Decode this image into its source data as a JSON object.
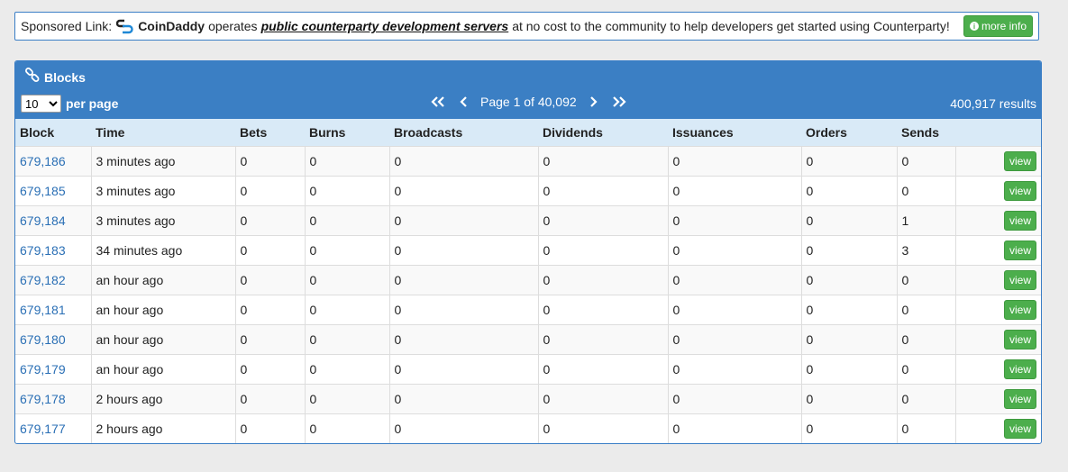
{
  "sponsor": {
    "prefix": "Sponsored Link:",
    "brand": "CoinDaddy",
    "text1": "operates",
    "link": "public counterparty development servers",
    "text2": "at no cost to the community to help developers get started using Counterparty!",
    "more_info": "more info",
    "logo_icon": "coindaddy-logo-icon",
    "info_icon": "info-circle-icon"
  },
  "panel": {
    "title": "Blocks",
    "title_icon": "link-icon",
    "per_page_value": "10",
    "per_page_options": [
      "10"
    ],
    "per_page_label": "per page",
    "page_text": "Page 1 of 40,092",
    "results": "400,917 results"
  },
  "table": {
    "headers": [
      "Block",
      "Time",
      "Bets",
      "Burns",
      "Broadcasts",
      "Dividends",
      "Issuances",
      "Orders",
      "Sends"
    ],
    "view_label": "view",
    "rows": [
      {
        "block": "679,186",
        "time": "3 minutes ago",
        "bets": "0",
        "burns": "0",
        "broadcasts": "0",
        "dividends": "0",
        "issuances": "0",
        "orders": "0",
        "sends": "0"
      },
      {
        "block": "679,185",
        "time": "3 minutes ago",
        "bets": "0",
        "burns": "0",
        "broadcasts": "0",
        "dividends": "0",
        "issuances": "0",
        "orders": "0",
        "sends": "0"
      },
      {
        "block": "679,184",
        "time": "3 minutes ago",
        "bets": "0",
        "burns": "0",
        "broadcasts": "0",
        "dividends": "0",
        "issuances": "0",
        "orders": "0",
        "sends": "1"
      },
      {
        "block": "679,183",
        "time": "34 minutes ago",
        "bets": "0",
        "burns": "0",
        "broadcasts": "0",
        "dividends": "0",
        "issuances": "0",
        "orders": "0",
        "sends": "3"
      },
      {
        "block": "679,182",
        "time": "an hour ago",
        "bets": "0",
        "burns": "0",
        "broadcasts": "0",
        "dividends": "0",
        "issuances": "0",
        "orders": "0",
        "sends": "0"
      },
      {
        "block": "679,181",
        "time": "an hour ago",
        "bets": "0",
        "burns": "0",
        "broadcasts": "0",
        "dividends": "0",
        "issuances": "0",
        "orders": "0",
        "sends": "0"
      },
      {
        "block": "679,180",
        "time": "an hour ago",
        "bets": "0",
        "burns": "0",
        "broadcasts": "0",
        "dividends": "0",
        "issuances": "0",
        "orders": "0",
        "sends": "0"
      },
      {
        "block": "679,179",
        "time": "an hour ago",
        "bets": "0",
        "burns": "0",
        "broadcasts": "0",
        "dividends": "0",
        "issuances": "0",
        "orders": "0",
        "sends": "0"
      },
      {
        "block": "679,178",
        "time": "2 hours ago",
        "bets": "0",
        "burns": "0",
        "broadcasts": "0",
        "dividends": "0",
        "issuances": "0",
        "orders": "0",
        "sends": "0"
      },
      {
        "block": "679,177",
        "time": "2 hours ago",
        "bets": "0",
        "burns": "0",
        "broadcasts": "0",
        "dividends": "0",
        "issuances": "0",
        "orders": "0",
        "sends": "0"
      }
    ]
  },
  "colors": {
    "panel_header": "#3b7fc4",
    "table_header": "#d9eaf7",
    "link": "#2a6fb5",
    "button_green": "#4cae4c"
  }
}
